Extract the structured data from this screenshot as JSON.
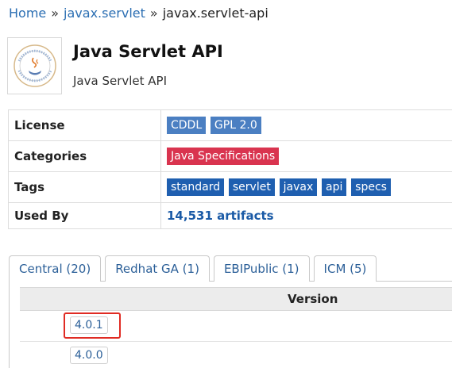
{
  "breadcrumb": {
    "home": "Home",
    "sep1": "»",
    "group": "javax.servlet",
    "sep2": "»",
    "artifact": "javax.servlet-api"
  },
  "logo": {
    "icon": "java-community-process-logo"
  },
  "title": "Java Servlet API",
  "subtitle": "Java Servlet API",
  "info": {
    "license_label": "License",
    "licenses": [
      "CDDL",
      "GPL 2.0"
    ],
    "categories_label": "Categories",
    "categories": [
      "Java Specifications"
    ],
    "tags_label": "Tags",
    "tags": [
      "standard",
      "servlet",
      "javax",
      "api",
      "specs"
    ],
    "usedby_label": "Used By",
    "usedby_value": "14,531 artifacts"
  },
  "tabs": [
    {
      "label": "Central (20)",
      "active": true
    },
    {
      "label": "Redhat GA (1)"
    },
    {
      "label": "EBIPublic (1)"
    },
    {
      "label": "ICM (5)"
    }
  ],
  "versions": {
    "header": "Version",
    "rows": [
      "4.0.1",
      "4.0.0"
    ],
    "highlighted": "4.0.1"
  },
  "colors": {
    "license_tag": "#4b7fc2",
    "category_tag": "#d9344f",
    "keyword_tag": "#1f5fb0",
    "highlight": "#e02b23"
  }
}
